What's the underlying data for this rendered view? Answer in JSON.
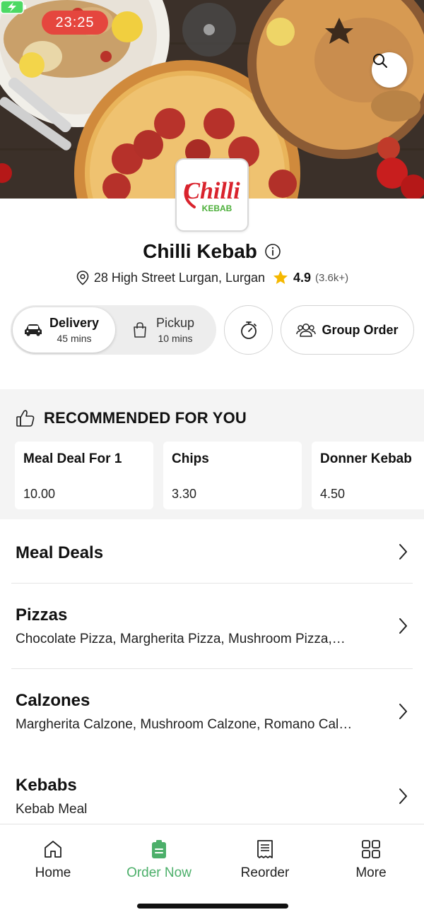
{
  "status_bar": {
    "time": "23:25"
  },
  "colors": {
    "accent_green": "#4caf6a",
    "time_pill": "#e5463e",
    "star": "#f5b800",
    "logo_red": "#d9232d",
    "logo_green": "#4caf3a"
  },
  "store": {
    "logo_text_main": "Chilli",
    "logo_text_sub": "KEBAB",
    "name": "Chilli Kebab",
    "address": "28 High Street Lurgan, Lurgan",
    "rating": "4.9",
    "reviews": "(3.6k+)"
  },
  "order_mode": {
    "delivery": {
      "label": "Delivery",
      "time": "45 mins"
    },
    "pickup": {
      "label": "Pickup",
      "time": "10 mins"
    },
    "group_order_label": "Group Order"
  },
  "recommended": {
    "title": "RECOMMENDED FOR YOU",
    "items": [
      {
        "name": "Meal Deal For 1",
        "price": "10.00"
      },
      {
        "name": "Chips",
        "price": "3.30"
      },
      {
        "name": "Donner Kebab",
        "price": "4.50"
      }
    ]
  },
  "categories": [
    {
      "name": "Meal Deals",
      "desc": ""
    },
    {
      "name": "Pizzas",
      "desc": "Chocolate Pizza, Margherita Pizza, Mushroom Pizza,…"
    },
    {
      "name": "Calzones",
      "desc": "Margherita Calzone, Mushroom Calzone, Romano Cal…"
    },
    {
      "name": "Kebabs",
      "desc": "Kebab Meal"
    }
  ],
  "bottom_nav": [
    {
      "label": "Home",
      "icon": "home-icon"
    },
    {
      "label": "Order Now",
      "icon": "order-bag-icon"
    },
    {
      "label": "Reorder",
      "icon": "receipt-icon"
    },
    {
      "label": "More",
      "icon": "grid-icon"
    }
  ]
}
